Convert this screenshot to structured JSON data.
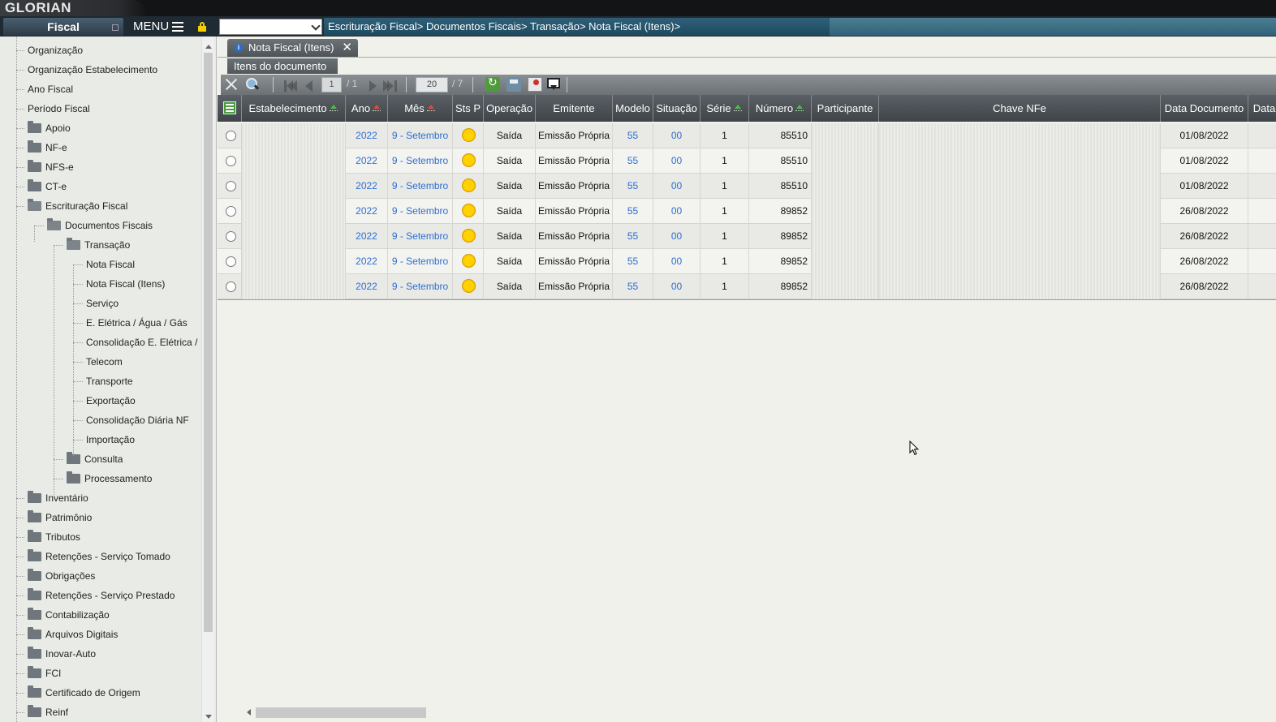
{
  "brand": {
    "logo_text": "GLORIAN"
  },
  "module": {
    "title": "Fiscal",
    "menu_label": "MENU"
  },
  "breadcrumb": {
    "text": "Escrituração Fiscal> Documentos Fiscais> Transação> Nota Fiscal (Itens)>"
  },
  "sidebar": {
    "items": [
      {
        "label": "Organização",
        "type": "leaf"
      },
      {
        "label": "Organização Estabelecimento",
        "type": "leaf"
      },
      {
        "label": "Ano Fiscal",
        "type": "leaf"
      },
      {
        "label": "Período Fiscal",
        "type": "leaf"
      },
      {
        "label": "Apoio",
        "type": "folder"
      },
      {
        "label": "NF-e",
        "type": "folder"
      },
      {
        "label": "NFS-e",
        "type": "folder"
      },
      {
        "label": "CT-e",
        "type": "folder"
      },
      {
        "label": "Escrituração Fiscal",
        "type": "folder-open"
      },
      {
        "label": "Documentos Fiscais",
        "type": "folder-open"
      },
      {
        "label": "Transação",
        "type": "folder-open"
      },
      {
        "label": "Nota Fiscal",
        "type": "leaf"
      },
      {
        "label": "Nota Fiscal (Itens)",
        "type": "leaf"
      },
      {
        "label": "Serviço",
        "type": "leaf"
      },
      {
        "label": "E. Elétrica / Água / Gás",
        "type": "leaf"
      },
      {
        "label": "Consolidação E. Elétrica /",
        "type": "leaf"
      },
      {
        "label": "Telecom",
        "type": "leaf"
      },
      {
        "label": "Transporte",
        "type": "leaf"
      },
      {
        "label": "Exportação",
        "type": "leaf"
      },
      {
        "label": "Consolidação Diária NF",
        "type": "leaf"
      },
      {
        "label": "Importação",
        "type": "leaf"
      },
      {
        "label": "Consulta",
        "type": "folder"
      },
      {
        "label": "Processamento",
        "type": "folder"
      },
      {
        "label": "Inventário",
        "type": "folder"
      },
      {
        "label": "Patrimônio",
        "type": "folder"
      },
      {
        "label": "Tributos",
        "type": "folder"
      },
      {
        "label": "Retenções - Serviço Tomado",
        "type": "folder"
      },
      {
        "label": "Obrigações",
        "type": "folder"
      },
      {
        "label": "Retenções - Serviço Prestado",
        "type": "folder"
      },
      {
        "label": "Contabilização",
        "type": "folder"
      },
      {
        "label": "Arquivos Digitais",
        "type": "folder"
      },
      {
        "label": "Inovar-Auto",
        "type": "folder"
      },
      {
        "label": "FCI",
        "type": "folder"
      },
      {
        "label": "Certificado de Origem",
        "type": "folder"
      },
      {
        "label": "Reinf",
        "type": "folder"
      }
    ]
  },
  "tabs": {
    "active_label": "Nota Fiscal (Itens)",
    "subtab_label": "Itens do documento"
  },
  "toolbar": {
    "page_current": "1",
    "page_total": "/ 1",
    "rows_per_page": "20",
    "rows_total": "/ 7"
  },
  "grid": {
    "columns": [
      "Estabelecimento",
      "Ano",
      "Mês",
      "Sts P",
      "Operação",
      "Emitente",
      "Modelo",
      "Situação",
      "Série",
      "Número",
      "Participante",
      "Chave NFe",
      "Data Documento",
      "Data"
    ],
    "rows": [
      {
        "ano": "2022",
        "mes": "9 - Setembro",
        "operacao": "Saída",
        "emitente": "Emissão Própria",
        "modelo": "55",
        "situacao": "00",
        "serie": "1",
        "numero": "85510",
        "data_documento": "01/08/2022"
      },
      {
        "ano": "2022",
        "mes": "9 - Setembro",
        "operacao": "Saída",
        "emitente": "Emissão Própria",
        "modelo": "55",
        "situacao": "00",
        "serie": "1",
        "numero": "85510",
        "data_documento": "01/08/2022"
      },
      {
        "ano": "2022",
        "mes": "9 - Setembro",
        "operacao": "Saída",
        "emitente": "Emissão Própria",
        "modelo": "55",
        "situacao": "00",
        "serie": "1",
        "numero": "85510",
        "data_documento": "01/08/2022"
      },
      {
        "ano": "2022",
        "mes": "9 - Setembro",
        "operacao": "Saída",
        "emitente": "Emissão Própria",
        "modelo": "55",
        "situacao": "00",
        "serie": "1",
        "numero": "89852",
        "data_documento": "26/08/2022"
      },
      {
        "ano": "2022",
        "mes": "9 - Setembro",
        "operacao": "Saída",
        "emitente": "Emissão Própria",
        "modelo": "55",
        "situacao": "00",
        "serie": "1",
        "numero": "89852",
        "data_documento": "26/08/2022"
      },
      {
        "ano": "2022",
        "mes": "9 - Setembro",
        "operacao": "Saída",
        "emitente": "Emissão Própria",
        "modelo": "55",
        "situacao": "00",
        "serie": "1",
        "numero": "89852",
        "data_documento": "26/08/2022"
      },
      {
        "ano": "2022",
        "mes": "9 - Setembro",
        "operacao": "Saída",
        "emitente": "Emissão Própria",
        "modelo": "55",
        "situacao": "00",
        "serie": "1",
        "numero": "89852",
        "data_documento": "26/08/2022"
      }
    ]
  },
  "colors": {
    "link": "#2e6fcf",
    "status_pending": "#ffd200",
    "breadcrumb_bg": "#2f5f78"
  }
}
